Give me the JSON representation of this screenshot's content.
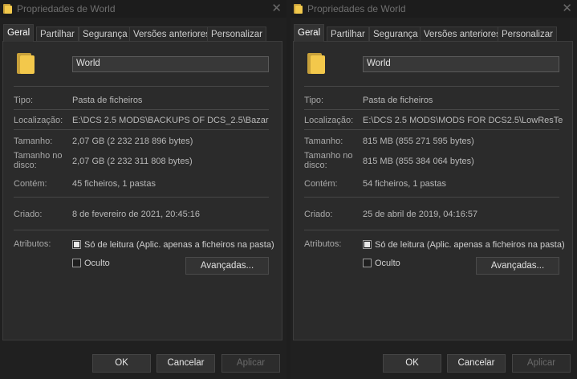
{
  "windows": [
    {
      "title": "Propriedades de World",
      "close_glyph": "✕",
      "tabs": [
        "Geral",
        "Partilhar",
        "Segurança",
        "Versões anteriores",
        "Personalizar"
      ],
      "active_tab": "Geral",
      "name": "World",
      "tipo_label": "Tipo:",
      "tipo": "Pasta de ficheiros",
      "localizacao_label": "Localização:",
      "localizacao": "E:\\DCS 2.5 MODS\\BACKUPS OF DCS_2.5\\Bazar",
      "tamanho_label": "Tamanho:",
      "tamanho": "2,07 GB (2 232 218 896 bytes)",
      "tamanho_disco_label_1": "Tamanho no",
      "tamanho_disco_label_2": "disco:",
      "tamanho_disco": "2,07 GB (2 232 311 808 bytes)",
      "contem_label": "Contém:",
      "contem": "45 ficheiros, 1 pastas",
      "criado_label": "Criado:",
      "criado": "8 de fevereiro de 2021, 20:45:16",
      "atributos_label": "Atributos:",
      "readonly_label": "Só de leitura (Aplic. apenas a ficheiros na pasta)",
      "hidden_label": "Oculto",
      "advanced_label": "Avançadas...",
      "ok_label": "OK",
      "cancel_label": "Cancelar",
      "apply_label": "Aplicar"
    },
    {
      "title": "Propriedades de World",
      "close_glyph": "✕",
      "tabs": [
        "Geral",
        "Partilhar",
        "Segurança",
        "Versões anteriores",
        "Personalizar"
      ],
      "active_tab": "Geral",
      "name": "World",
      "tipo_label": "Tipo:",
      "tipo": "Pasta de ficheiros",
      "localizacao_label": "Localização:",
      "localizacao": "E:\\DCS 2.5 MODS\\MODS FOR DCS2.5\\LowResTe",
      "tamanho_label": "Tamanho:",
      "tamanho": "815 MB (855 271 595 bytes)",
      "tamanho_disco_label_1": "Tamanho no",
      "tamanho_disco_label_2": "disco:",
      "tamanho_disco": "815 MB (855 384 064 bytes)",
      "contem_label": "Contém:",
      "contem": "54 ficheiros, 1 pastas",
      "criado_label": "Criado:",
      "criado": "25 de abril de 2019, 04:16:57",
      "atributos_label": "Atributos:",
      "readonly_label": "Só de leitura (Aplic. apenas a ficheiros na pasta)",
      "hidden_label": "Oculto",
      "advanced_label": "Avançadas...",
      "ok_label": "OK",
      "cancel_label": "Cancelar",
      "apply_label": "Aplicar"
    }
  ],
  "colors": {
    "folder": "#f2c94c",
    "background": "#202020",
    "panel": "#2b2b2b"
  },
  "icons": {
    "folder": "folder-icon",
    "close": "close-icon"
  }
}
